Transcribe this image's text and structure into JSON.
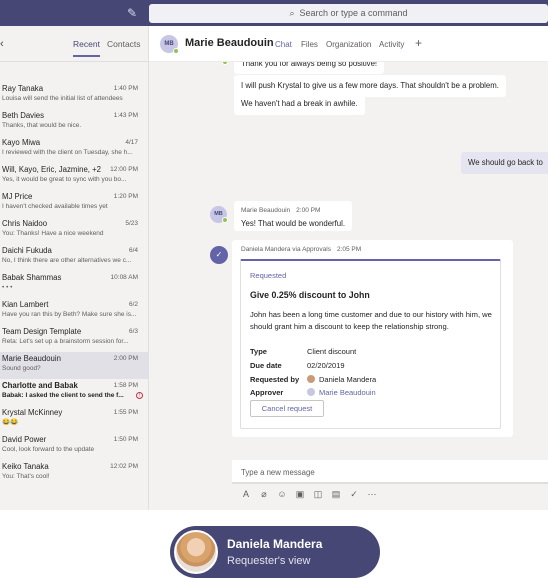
{
  "search": {
    "placeholder": "Search or type a command",
    "icon": "search-icon"
  },
  "left_pane": {
    "tabs": [
      {
        "label": "Recent",
        "active": true
      },
      {
        "label": "Contacts",
        "active": false
      }
    ],
    "chats": [
      {
        "name": "Ray Tanaka",
        "time": "1:40 PM",
        "preview": "Louisa will send the initial list of attendees"
      },
      {
        "name": "Beth Davies",
        "time": "1:43 PM",
        "preview": "Thanks, that would be nice."
      },
      {
        "name": "Kayo Miwa",
        "time": "4/17",
        "preview": "I reviewed with the client on Tuesday, she h..."
      },
      {
        "name": "Will, Kayo, Eric, Jazmine, +2",
        "time": "12:00 PM",
        "preview": "Yes, it would be great to sync with you bo..."
      },
      {
        "name": "MJ Price",
        "time": "1:20 PM",
        "preview": "I haven't checked available times yet"
      },
      {
        "name": "Chris Naidoo",
        "time": "5/23",
        "preview": "You: Thanks! Have a nice weekend"
      },
      {
        "name": "Daichi Fukuda",
        "time": "6/4",
        "preview": "No, I think there are other alternatives we c..."
      },
      {
        "name": "Babak Shammas",
        "time": "10:08 AM",
        "preview": "• • •"
      },
      {
        "name": "Kian Lambert",
        "time": "6/2",
        "preview": "Have you ran this by Beth? Make sure she is..."
      },
      {
        "name": "Team Design Template",
        "time": "6/3",
        "preview": "Reta: Let's set up a brainstorm session for..."
      },
      {
        "name": "Marie Beaudouin",
        "time": "2:00 PM",
        "preview": "Sound good?",
        "selected": true
      },
      {
        "name": "Charlotte and Babak",
        "time": "1:58 PM",
        "preview": "Babak: I asked the client to send the f...",
        "bold": true,
        "urgent": true
      },
      {
        "name": "Krystal McKinney",
        "time": "1:55 PM",
        "preview": "😂😂"
      },
      {
        "name": "David Power",
        "time": "1:50 PM",
        "preview": "Cool, look forward to the update"
      },
      {
        "name": "Keiko Tanaka",
        "time": "12:02 PM",
        "preview": "You: That's cool!"
      }
    ]
  },
  "header": {
    "avatar_initials": "MB",
    "name": "Marie Beaudouin",
    "tabs": [
      {
        "label": "Chat",
        "active": true
      },
      {
        "label": "Files",
        "active": false
      },
      {
        "label": "Organization",
        "active": false
      },
      {
        "label": "Activity",
        "active": false
      }
    ],
    "add_tab": "+"
  },
  "messages": {
    "m1": "Thank you for always being so positive!",
    "m2": "I will push Krystal to give us a few more days. That shouldn't be a problem.",
    "m3": "We haven't had a break in awhile.",
    "mine": "We should go back to",
    "reply_avatar": "MB",
    "reply_author": "Marie Beaudouin",
    "reply_time": "2:00 PM",
    "reply_text": "Yes! That would be wonderful."
  },
  "approval": {
    "author": "Daniela Mandera via Approvals",
    "time": "2:05 PM",
    "status": "Requested",
    "title": "Give 0.25% discount to John",
    "description": "John has been a long time customer and due to our history with him, we should grant him a discount to keep the relationship strong.",
    "fields": [
      {
        "key": "Type",
        "value": "Client discount"
      },
      {
        "key": "Due date",
        "value": "02/20/2019"
      },
      {
        "key": "Requested by",
        "value": "Daniela Mandera"
      },
      {
        "key": "Approver",
        "value": "Marie Beaudouin"
      }
    ],
    "cancel_label": "Cancel request"
  },
  "composer": {
    "placeholder": "Type a new message"
  },
  "toolbar_icons": [
    "format-icon",
    "attach-icon",
    "emoji-icon",
    "gif-icon",
    "sticker-icon",
    "meet-icon",
    "approvals-icon",
    "more-icon"
  ],
  "overlay": {
    "name": "Daniela Mandera",
    "subtitle": "Requester's view"
  },
  "colors": {
    "brand": "#464775",
    "accent": "#6264a7",
    "presence": "#92c353"
  }
}
